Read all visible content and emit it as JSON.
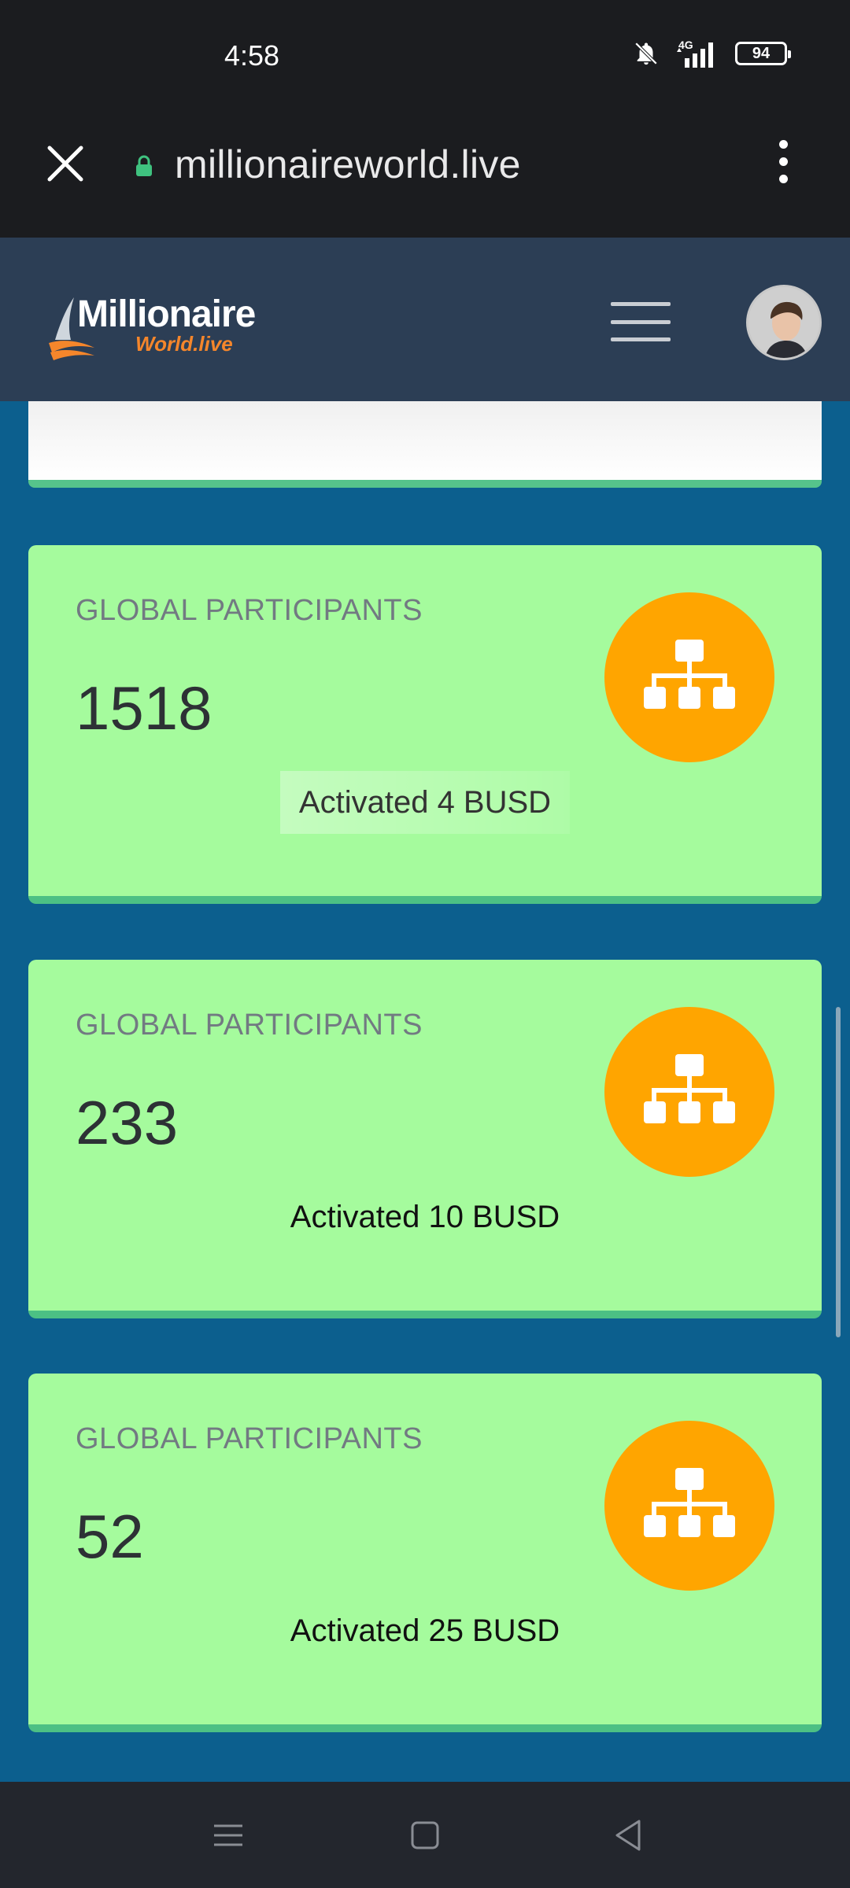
{
  "status_bar": {
    "time": "4:58",
    "network": "4G",
    "battery": "94",
    "icons": [
      "mute-bell-icon",
      "signal-icon",
      "battery-icon"
    ]
  },
  "browser": {
    "url": "millionaireworld.live",
    "icons": [
      "close-icon",
      "lock-icon",
      "more-vert-icon"
    ]
  },
  "header": {
    "logo_main": "Millionaire",
    "logo_sub": "World.live",
    "icons": [
      "hamburger-icon",
      "avatar"
    ]
  },
  "cards": [
    {
      "label": "GLOBAL PARTICIPANTS",
      "value": "1518",
      "status": "Activated 4 BUSD",
      "icon": "sitemap-icon"
    },
    {
      "label": "GLOBAL PARTICIPANTS",
      "value": "233",
      "status": "Activated 10 BUSD",
      "icon": "sitemap-icon"
    },
    {
      "label": "GLOBAL PARTICIPANTS",
      "value": "52",
      "status": "Activated 25 BUSD",
      "icon": "sitemap-icon"
    }
  ],
  "colors": {
    "header_bg": "#2c3e55",
    "content_bg": "#0c5f8e",
    "card_bg": "#a5fb9d",
    "card_border": "#4cc084",
    "icon_circle": "#ffa500",
    "logo_accent": "#f5862b"
  },
  "nav": {
    "icons": [
      "recent-apps-icon",
      "home-icon",
      "back-icon"
    ]
  }
}
